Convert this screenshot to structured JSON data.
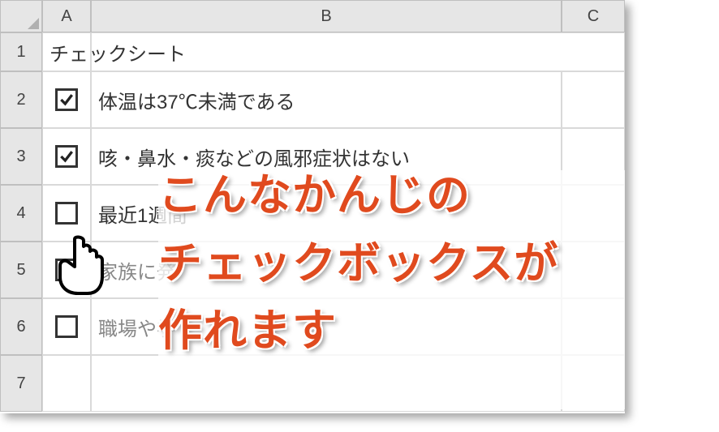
{
  "columns": {
    "A": "A",
    "B": "B",
    "C": "C"
  },
  "rows": {
    "r1": {
      "num": "1",
      "title": "チェックシート"
    },
    "r2": {
      "num": "2",
      "checked": true,
      "text": "体温は37℃未満である"
    },
    "r3": {
      "num": "3",
      "checked": true,
      "text": "咳・鼻水・痰などの風邪症状はない"
    },
    "r4": {
      "num": "4",
      "checked": false,
      "text": "最近1週間"
    },
    "r5": {
      "num": "5",
      "checked": false,
      "text": "家族に発"
    },
    "r6": {
      "num": "6",
      "checked": false,
      "text": "職場や学"
    },
    "r7": {
      "num": "7"
    }
  },
  "overlay": {
    "line1": "こんなかんじの",
    "line2": "チェックボックスが",
    "line3": "作れます"
  }
}
